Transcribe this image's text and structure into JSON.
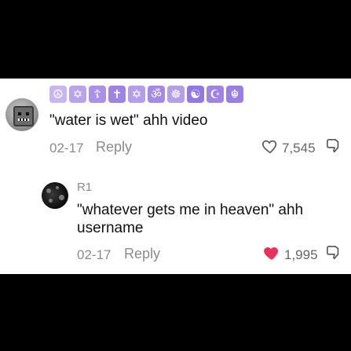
{
  "comment": {
    "badges": [
      "☮",
      "✡",
      "☦",
      "✝",
      "✡",
      "ॐ",
      "☸",
      "☯",
      "☪",
      "☬"
    ],
    "text": "\"water is wet\" ahh video",
    "date": "02-17",
    "reply_label": "Reply",
    "likes": "7,545",
    "liked": false
  },
  "reply": {
    "username": "R1",
    "text_line1": "\"whatever gets me in heaven\" ahh",
    "text_line2": "username",
    "date": "02-17",
    "reply_label": "Reply",
    "likes": "1,995",
    "liked": true,
    "like_color": "#e8325a"
  }
}
